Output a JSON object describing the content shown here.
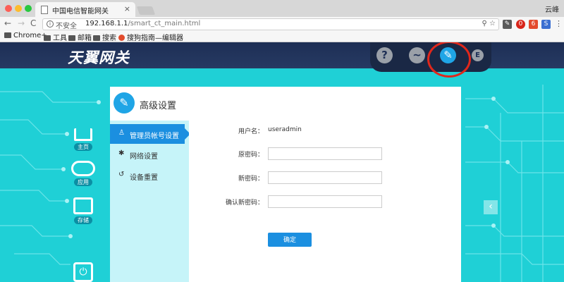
{
  "browser": {
    "tab_title": "中国电信智能网关",
    "tab_close": "×",
    "profile_name": "云峰",
    "nav_back": "←",
    "nav_forward": "→",
    "nav_reload": "C",
    "insecure_label": "不安全",
    "url_host": "192.168.1.1",
    "url_path": "/smart_ct_main.html",
    "omnibox_icons": "⚲ ☆",
    "bookmarks": [
      "Chrome+",
      "工具",
      "邮箱",
      "搜索",
      "搜狗指南—编辑器"
    ]
  },
  "app": {
    "logo_text": "天翼网关",
    "top_icons": {
      "help": "?",
      "status": "~",
      "settings": "✎",
      "logout": "E"
    },
    "rail": {
      "home_label": "主页",
      "apps_label": "应用",
      "storage_label": "存储"
    },
    "sidebar": {
      "title": "高级设置",
      "items": [
        {
          "icon": "person-icon",
          "label": "管理员帐号设置"
        },
        {
          "icon": "gear-icon",
          "label": "网络设置"
        },
        {
          "icon": "reset-icon",
          "label": "设备重置"
        }
      ]
    },
    "form": {
      "username_label": "用户名：",
      "username_value": "useradmin",
      "old_password_label": "原密码：",
      "new_password_label": "新密码：",
      "confirm_password_label": "确认新密码：",
      "submit_label": "确定"
    },
    "colors": {
      "accent": "#1b8fe0",
      "background": "#1fd0d6",
      "header": "#1e2f55",
      "highlight": "#e0271b"
    }
  }
}
